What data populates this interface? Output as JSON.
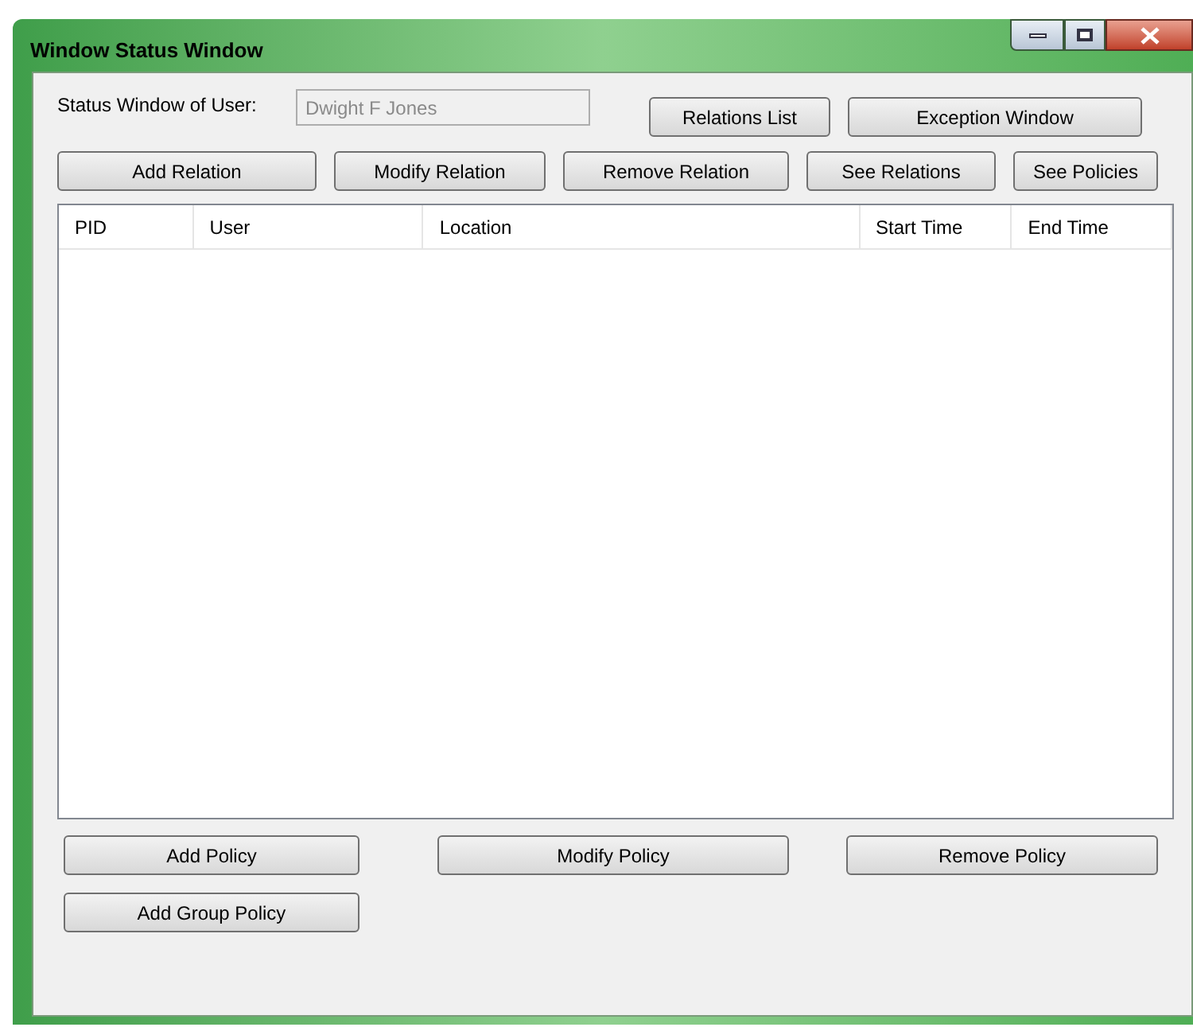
{
  "window": {
    "title": "Window Status Window"
  },
  "user_field": {
    "label": "Status Window of User:",
    "value": "Dwight F Jones",
    "disabled": true
  },
  "top_buttons": [
    "Relations List",
    "Exception Window"
  ],
  "relation_buttons": [
    "Add Relation",
    "Modify Relation",
    "Remove Relation",
    "See Relations",
    "See Policies"
  ],
  "table": {
    "columns": [
      "PID",
      "User",
      "Location",
      "Start Time",
      "End Time"
    ]
  },
  "policy_buttons": [
    "Add Policy",
    "Modify Policy",
    "Remove Policy"
  ],
  "group_policy_button": "Add Group Policy"
}
